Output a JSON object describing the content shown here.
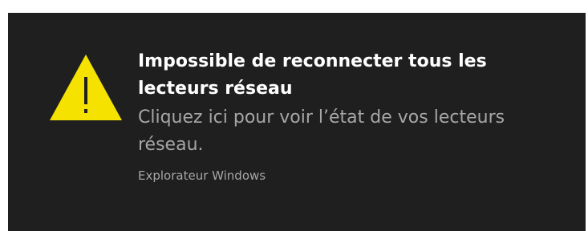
{
  "notification": {
    "icon": "warning-icon",
    "icon_color": "#f5e200",
    "background_color": "#1f1f1f",
    "title": "Impossible de reconnecter tous les lecteurs réseau",
    "body": "Cliquez ici pour voir l’état de vos lecteurs réseau.",
    "source": "Explorateur Windows"
  }
}
